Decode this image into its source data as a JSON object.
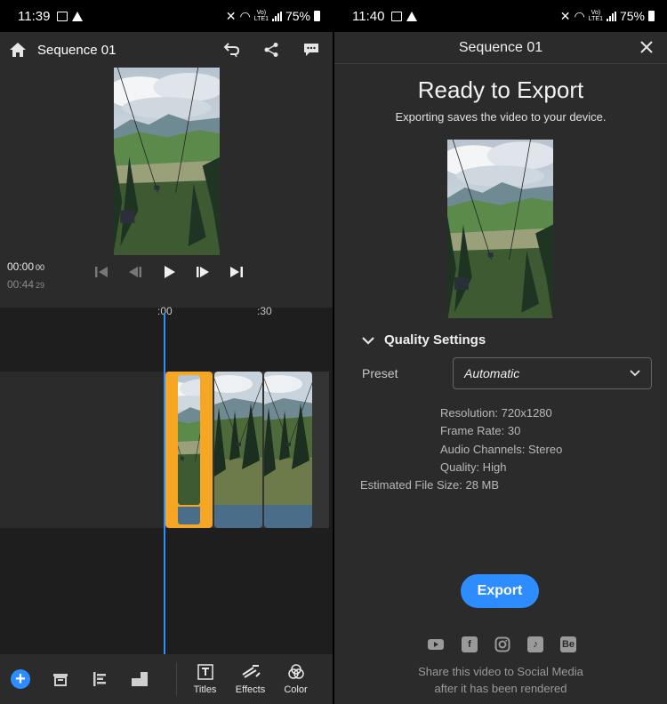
{
  "left_screen": {
    "status_bar": {
      "time": "11:39",
      "network": "Vo)\nLTE1",
      "battery": "75%"
    },
    "header": {
      "title": "Sequence 01"
    },
    "timecode": {
      "current": "00:00",
      "current_frames": "00",
      "duration": "00:44",
      "duration_frames": "29"
    },
    "ruler": {
      "mark_start": ":00",
      "mark_30": ":30"
    },
    "bottom_tabs": [
      {
        "label": "Titles"
      },
      {
        "label": "Effects"
      },
      {
        "label": "Color"
      }
    ]
  },
  "right_screen": {
    "status_bar": {
      "time": "11:40",
      "network": "Vo)\nLTE1",
      "battery": "75%"
    },
    "header": {
      "title": "Sequence 01"
    },
    "heading": "Ready to Export",
    "subheading": "Exporting saves the video to your device.",
    "quality": {
      "section_label": "Quality Settings",
      "preset_label": "Preset",
      "preset_value": "Automatic"
    },
    "specs": {
      "resolution": "Resolution: 720x1280",
      "frame_rate": "Frame Rate: 30",
      "audio": "Audio Channels: Stereo",
      "quality": "Quality: High",
      "file_size": "Estimated File Size: 28 MB"
    },
    "export_label": "Export",
    "social_icons": [
      "youtube-icon",
      "facebook-icon",
      "instagram-icon",
      "tiktok-icon",
      "behance-icon"
    ],
    "share_line1": "Share this video to Social Media",
    "share_line2": "after it has been rendered"
  },
  "colors": {
    "accent": "#2d8cff",
    "selected_clip": "#f5a623",
    "panel": "#2b2b2b",
    "timeline": "#1e1e1e"
  }
}
